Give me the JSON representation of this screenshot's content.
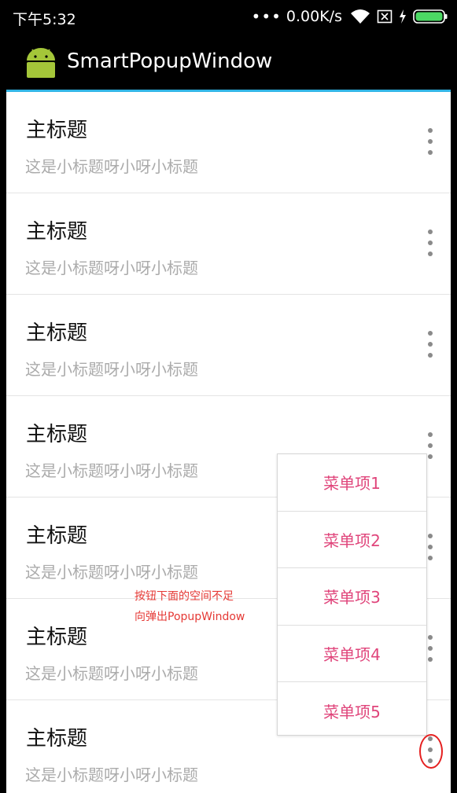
{
  "status_bar": {
    "time": "下午5:32",
    "dots": "•••",
    "network_speed": "0.00K/s",
    "icons": [
      "wifi-icon",
      "sim-card-icon",
      "charging-icon",
      "battery-icon"
    ],
    "battery_color": "#4cd964"
  },
  "app_bar": {
    "title": "SmartPopupWindow",
    "logo": "android-logo-icon",
    "accent_color": "#33b5e5"
  },
  "list": {
    "items": [
      {
        "title": "主标题",
        "subtitle": "这是小标题呀小呀小标题"
      },
      {
        "title": "主标题",
        "subtitle": "这是小标题呀小呀小标题"
      },
      {
        "title": "主标题",
        "subtitle": "这是小标题呀小呀小标题"
      },
      {
        "title": "主标题",
        "subtitle": "这是小标题呀小呀小标题"
      },
      {
        "title": "主标题",
        "subtitle": "这是小标题呀小呀小标题"
      },
      {
        "title": "主标题",
        "subtitle": "这是小标题呀小呀小标题"
      },
      {
        "title": "主标题",
        "subtitle": "这是小标题呀小呀小标题"
      }
    ],
    "more_icon": "more-vertical-icon"
  },
  "popup_menu": {
    "items": [
      "菜单项1",
      "菜单项2",
      "菜单项3",
      "菜单项4",
      "菜单项5"
    ],
    "text_color": "#e0457b"
  },
  "annotation": {
    "line1": "按钮下面的空间不足",
    "line2": "向弹出PopupWindow",
    "color": "#e53935"
  }
}
